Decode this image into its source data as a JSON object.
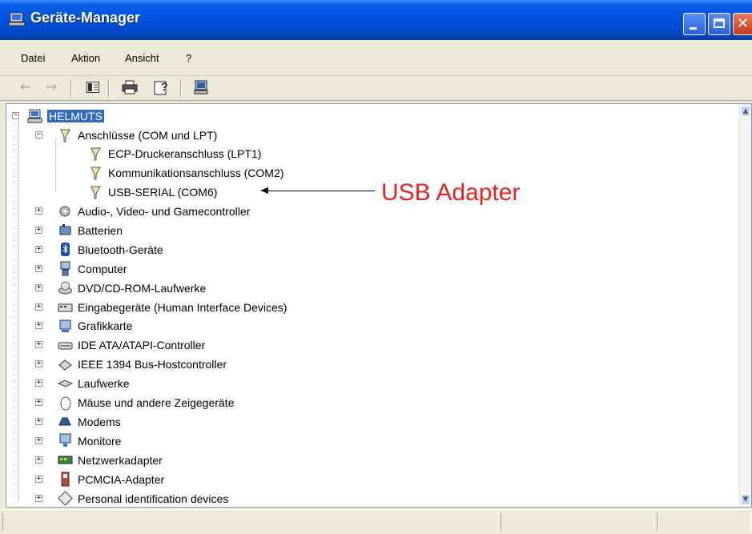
{
  "window": {
    "title": "Geräte-Manager"
  },
  "menu": [
    "Datei",
    "Aktion",
    "Ansicht",
    "?"
  ],
  "tree": {
    "root": "HELMUTS",
    "ports_group": "Anschlüsse (COM und LPT)",
    "ports": [
      "ECP-Druckeranschluss (LPT1)",
      "Kommunikationsanschluss (COM2)",
      "USB-SERIAL (COM6)"
    ],
    "categories": [
      {
        "label": "Audio-, Video- und Gamecontroller",
        "icon": "audio-icon"
      },
      {
        "label": "Batterien",
        "icon": "battery-icon"
      },
      {
        "label": "Bluetooth-Geräte",
        "icon": "bluetooth-icon"
      },
      {
        "label": "Computer",
        "icon": "computer-icon"
      },
      {
        "label": "DVD/CD-ROM-Laufwerke",
        "icon": "cdrom-icon"
      },
      {
        "label": "Eingabegeräte (Human Interface Devices)",
        "icon": "hid-icon"
      },
      {
        "label": "Grafikkarte",
        "icon": "display-adapter-icon"
      },
      {
        "label": "IDE ATA/ATAPI-Controller",
        "icon": "ide-controller-icon"
      },
      {
        "label": "IEEE 1394 Bus-Hostcontroller",
        "icon": "firewire-icon"
      },
      {
        "label": "Laufwerke",
        "icon": "disk-drive-icon"
      },
      {
        "label": "Mäuse und andere Zeigegeräte",
        "icon": "mouse-icon"
      },
      {
        "label": "Modems",
        "icon": "modem-icon"
      },
      {
        "label": "Monitore",
        "icon": "monitor-icon"
      },
      {
        "label": "Netzwerkadapter",
        "icon": "network-adapter-icon"
      },
      {
        "label": "PCMCIA-Adapter",
        "icon": "pcmcia-icon"
      },
      {
        "label": "Personal identification devices",
        "icon": "pid-icon"
      }
    ]
  },
  "annotation": {
    "text": "USB Adapter",
    "color": "#E8231E"
  },
  "colors": {
    "titlebar": "#0052DE",
    "selection": "#316AC5",
    "chrome": "#ECE9D8"
  }
}
